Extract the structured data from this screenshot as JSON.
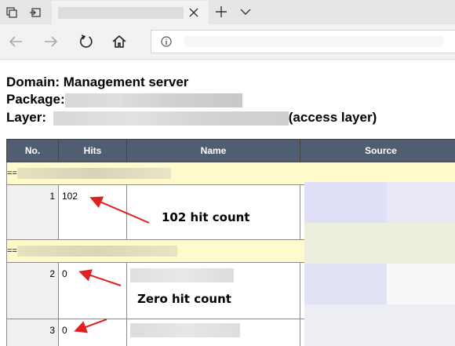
{
  "browser": {
    "tab": {
      "title": ""
    },
    "address": {
      "url": ""
    }
  },
  "page": {
    "domain_line": "Domain: Management server",
    "package_label": "Package:",
    "layer_label": "Layer:",
    "layer_suffix": "(access layer)"
  },
  "table": {
    "columns": [
      "No.",
      "Hits",
      "Name",
      "Source"
    ],
    "section_prefix": "==",
    "rows": [
      {
        "no": "1",
        "hits": "102"
      },
      {
        "no": "2",
        "hits": "0"
      },
      {
        "no": "3",
        "hits": "0"
      }
    ]
  },
  "annotations": {
    "first": "102 hit count",
    "second": "Zero hit count",
    "arrow_color": "#e02020"
  },
  "icons": [
    "tab-manager-icon",
    "set-aside-tabs-icon",
    "close-icon",
    "plus-icon",
    "chevron-down-icon",
    "back-icon",
    "forward-icon",
    "refresh-icon",
    "home-icon",
    "info-icon"
  ]
}
